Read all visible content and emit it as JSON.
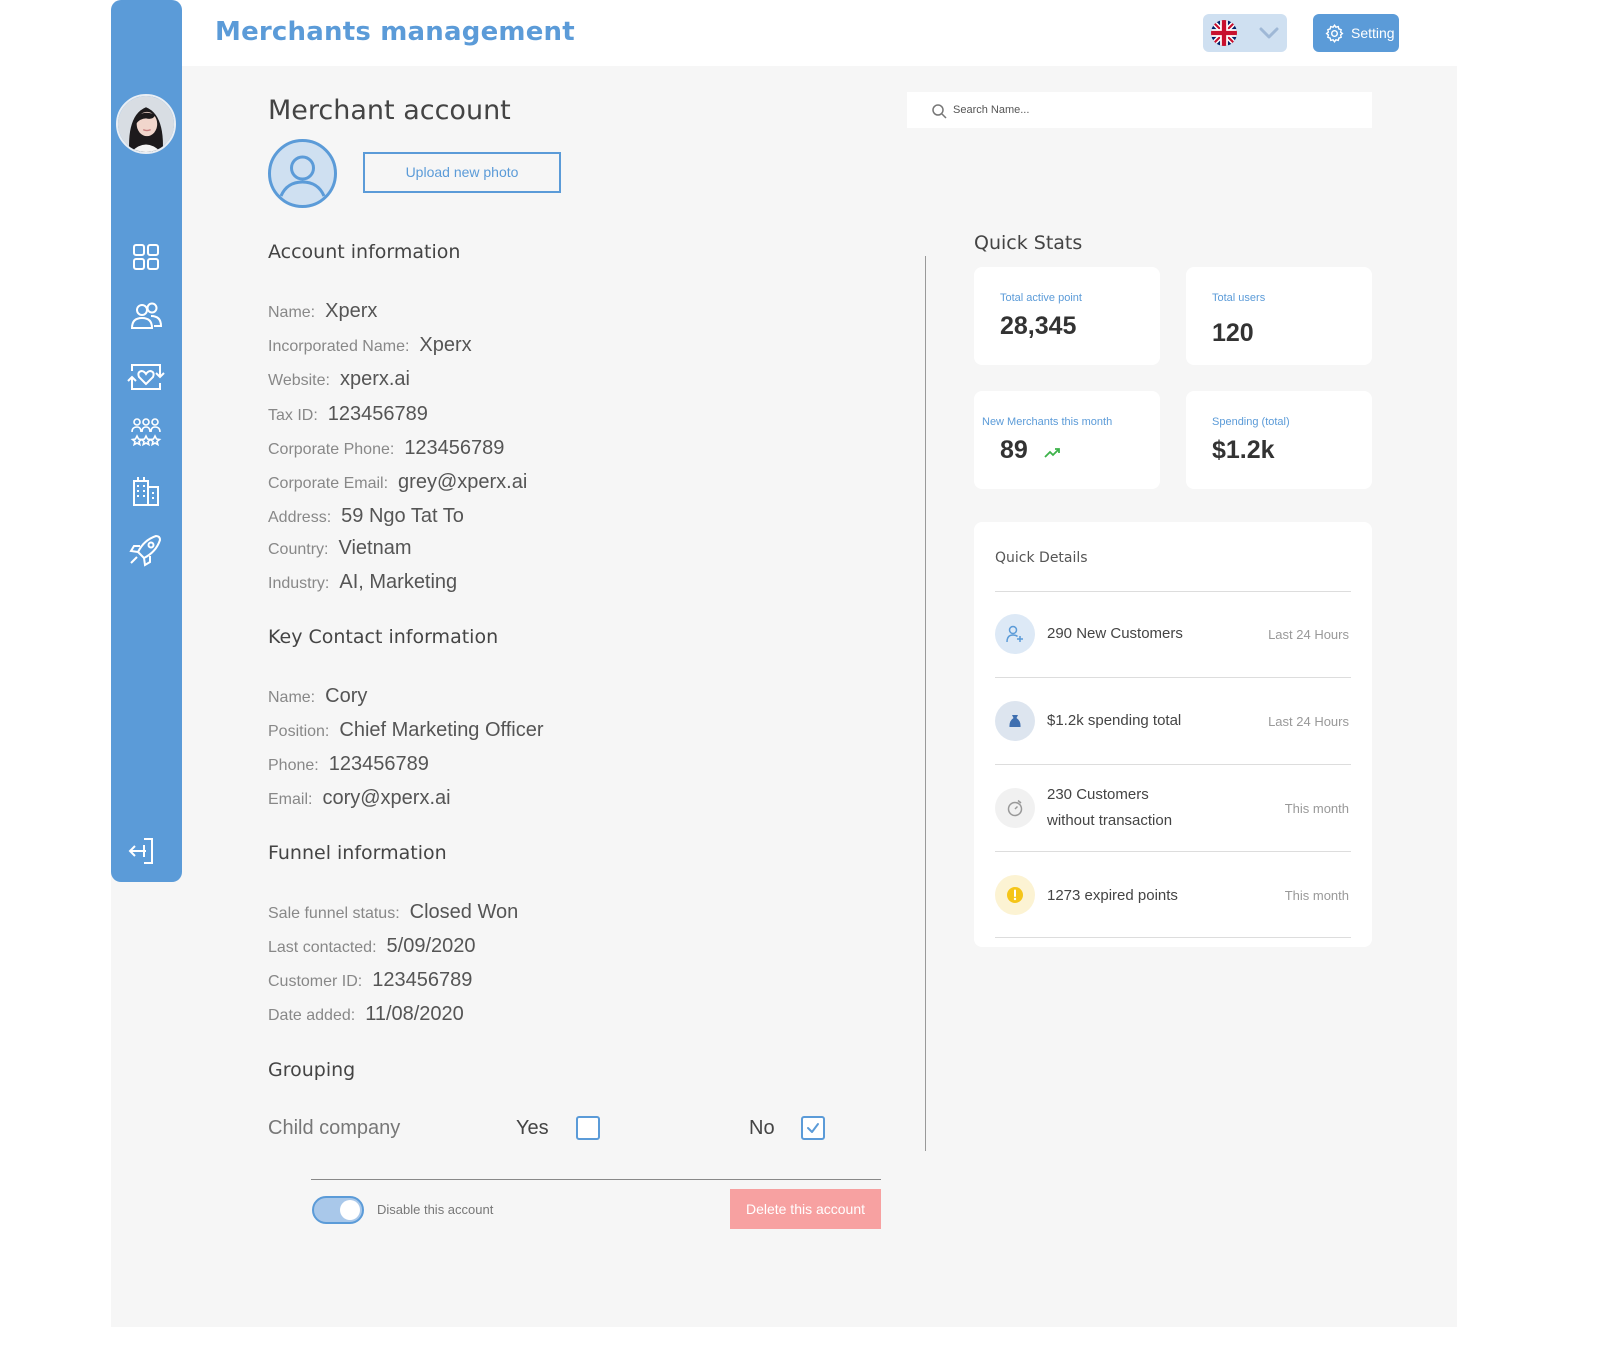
{
  "header": {
    "app_title": "Merchants management",
    "language_flag": "uk-flag-icon",
    "setting_label": "Setting"
  },
  "sidebar": {
    "items": [
      {
        "name": "dashboard",
        "icon": "grid-icon"
      },
      {
        "name": "users",
        "icon": "users-icon"
      },
      {
        "name": "loyalty",
        "icon": "heart-exchange-icon"
      },
      {
        "name": "groups",
        "icon": "group-icon"
      },
      {
        "name": "merchants",
        "icon": "buildings-icon"
      },
      {
        "name": "campaigns",
        "icon": "rocket-icon"
      }
    ],
    "logout_icon": "logout-icon"
  },
  "main": {
    "page_title": "Merchant account",
    "upload_label": "Upload new photo",
    "account": {
      "title": "Account information",
      "fields": [
        {
          "label": "Name:",
          "value": "Xperx"
        },
        {
          "label": "Incorporated Name:",
          "value": "Xperx"
        },
        {
          "label": "Website:",
          "value": "xperx.ai"
        },
        {
          "label": "Tax ID:",
          "value": "123456789"
        },
        {
          "label": "Corporate Phone:",
          "value": "123456789"
        },
        {
          "label": "Corporate Email:",
          "value": "grey@xperx.ai"
        },
        {
          "label": "Address:",
          "value": "59 Ngo Tat To"
        },
        {
          "label": "Country:",
          "value": "Vietnam"
        },
        {
          "label": "Industry:",
          "value": "AI, Marketing"
        }
      ]
    },
    "contact": {
      "title": "Key Contact information",
      "fields": [
        {
          "label": "Name:",
          "value": "Cory"
        },
        {
          "label": "Position:",
          "value": "Chief Marketing Officer"
        },
        {
          "label": "Phone:",
          "value": "123456789"
        },
        {
          "label": "Email:",
          "value": "cory@xperx.ai"
        }
      ]
    },
    "funnel": {
      "title": "Funnel information",
      "fields": [
        {
          "label": "Sale funnel status:",
          "value": "Closed Won"
        },
        {
          "label": "Last contacted:",
          "value": "5/09/2020"
        },
        {
          "label": "Customer ID:",
          "value": "123456789"
        },
        {
          "label": "Date added:",
          "value": "11/08/2020"
        }
      ]
    },
    "grouping": {
      "title": "Grouping",
      "label": "Child company",
      "yes_label": "Yes",
      "no_label": "No",
      "yes_checked": false,
      "no_checked": true
    },
    "footer": {
      "disable_label": "Disable this account",
      "disable_on": true,
      "delete_label": "Delete this account"
    }
  },
  "search": {
    "placeholder": "Search Name..."
  },
  "quick_stats": {
    "title": "Quick Stats",
    "cards": [
      {
        "label": "Total active point",
        "value": "28,345"
      },
      {
        "label": "Total users",
        "value": "120"
      },
      {
        "label": "New Merchants this month",
        "value": "89",
        "trend": "trend-up-icon"
      },
      {
        "label": "Spending (total)",
        "value": "$1.2k"
      }
    ]
  },
  "quick_details": {
    "title": "Quick Details",
    "items": [
      {
        "text": "290 New Customers",
        "time": "Last 24 Hours",
        "icon": "add-user-icon",
        "color": "#dde9f6"
      },
      {
        "text": "$1.2k spending total",
        "time": "Last 24 Hours",
        "icon": "money-bag-icon",
        "color": "#dde5ef"
      },
      {
        "text_1": "230 Customers",
        "text_2": "without transaction",
        "time": "This month",
        "icon": "timer-icon",
        "color": "#f1f1f1"
      },
      {
        "text": "1273 expired points",
        "time": "This month",
        "icon": "warning-icon",
        "color": "#fcf3d3"
      }
    ]
  },
  "colors": {
    "accent": "#5b9bd8",
    "danger": "#f7a1a1",
    "background": "#f6f6f6"
  }
}
